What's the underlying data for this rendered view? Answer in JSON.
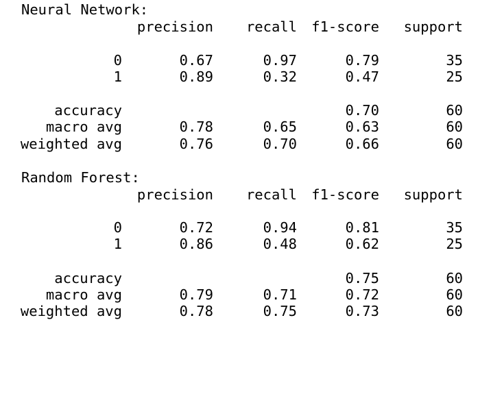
{
  "reports": [
    {
      "title": "Neural Network:",
      "headers": {
        "precision": "precision",
        "recall": "recall",
        "f1_score": "f1-score",
        "support": "support"
      },
      "classes": [
        {
          "label": "0",
          "precision": "0.67",
          "recall": "0.97",
          "f1_score": "0.79",
          "support": "35"
        },
        {
          "label": "1",
          "precision": "0.89",
          "recall": "0.32",
          "f1_score": "0.47",
          "support": "25"
        }
      ],
      "accuracy": {
        "label": "accuracy",
        "f1_score": "0.70",
        "support": "60"
      },
      "macro_avg": {
        "label": "macro avg",
        "precision": "0.78",
        "recall": "0.65",
        "f1_score": "0.63",
        "support": "60"
      },
      "weighted_avg": {
        "label": "weighted avg",
        "precision": "0.76",
        "recall": "0.70",
        "f1_score": "0.66",
        "support": "60"
      }
    },
    {
      "title": "Random Forest:",
      "headers": {
        "precision": "precision",
        "recall": "recall",
        "f1_score": "f1-score",
        "support": "support"
      },
      "classes": [
        {
          "label": "0",
          "precision": "0.72",
          "recall": "0.94",
          "f1_score": "0.81",
          "support": "35"
        },
        {
          "label": "1",
          "precision": "0.86",
          "recall": "0.48",
          "f1_score": "0.62",
          "support": "25"
        }
      ],
      "accuracy": {
        "label": "accuracy",
        "f1_score": "0.75",
        "support": "60"
      },
      "macro_avg": {
        "label": "macro avg",
        "precision": "0.79",
        "recall": "0.71",
        "f1_score": "0.72",
        "support": "60"
      },
      "weighted_avg": {
        "label": "weighted avg",
        "precision": "0.78",
        "recall": "0.75",
        "f1_score": "0.73",
        "support": "60"
      }
    }
  ]
}
